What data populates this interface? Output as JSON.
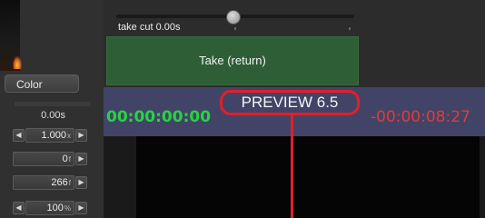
{
  "top": {
    "take_cut_label": "take cut 0.00s",
    "take_cut_seconds": 0.0
  },
  "take_button": {
    "label": "Take (return)"
  },
  "timecode": {
    "start": "00:00:00:00",
    "remaining": "-00:00:08:27"
  },
  "preview_badge": {
    "label": "PREVIEW 6.5"
  },
  "sidebar": {
    "color_button": "Color",
    "duration_value": "0.00s",
    "steppers": [
      {
        "value": "1.000",
        "unit": "x"
      },
      {
        "value": "0",
        "unit": "f"
      },
      {
        "value": "266",
        "unit": "f"
      },
      {
        "value": "100",
        "unit": "%"
      }
    ]
  },
  "colors": {
    "take_button": "#2e5e36",
    "timecode_start": "#27d441",
    "timecode_remaining": "#e03b3b",
    "annotation": "#e0202a",
    "timeline_bar": "#414467"
  }
}
